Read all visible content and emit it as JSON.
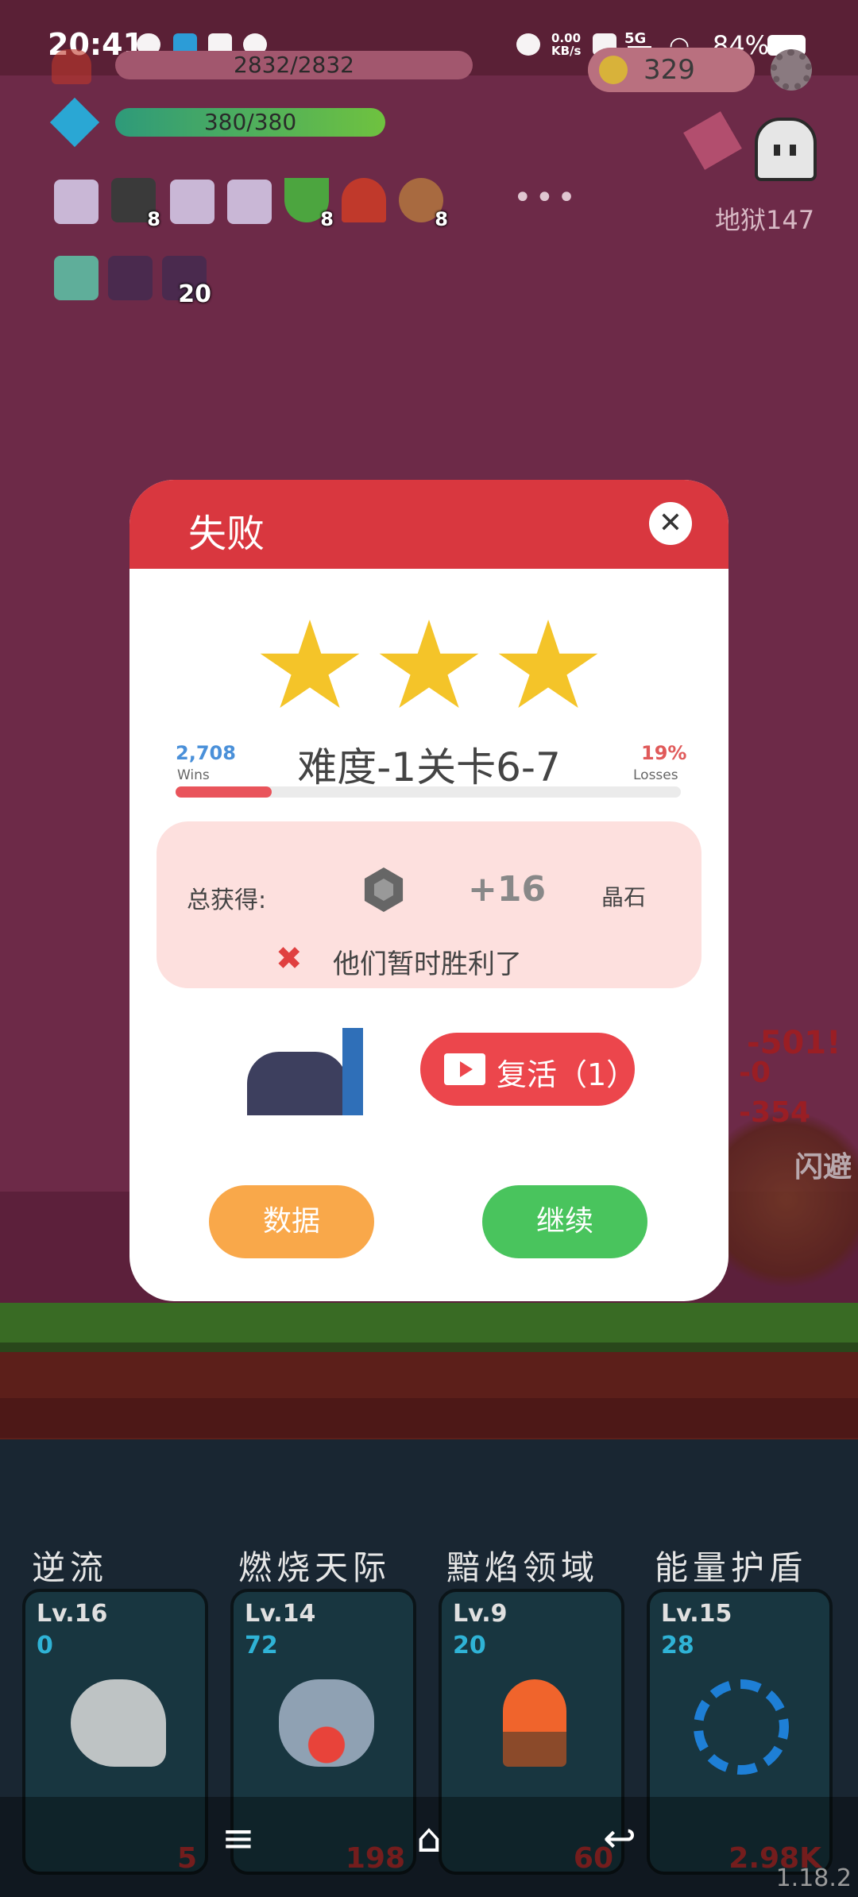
{
  "status_bar": {
    "time": "20:41",
    "network_speed": "0.00\nKB/s",
    "network_type": "5G",
    "battery_percent": "84%"
  },
  "hud": {
    "hp_text": "2832/2832",
    "mana_text": "380/380",
    "gold_amount": "329",
    "hell_level": "地狱147",
    "overflow_dots": "•••",
    "items": [
      {
        "icon": "scroll-icon",
        "count": ""
      },
      {
        "icon": "skull-book-icon",
        "count": "8"
      },
      {
        "icon": "scroll-icon",
        "count": ""
      },
      {
        "icon": "scroll-icon",
        "count": ""
      },
      {
        "icon": "watermelon-icon",
        "count": "8"
      },
      {
        "icon": "magnet-icon",
        "count": ""
      },
      {
        "icon": "target-icon",
        "count": "8"
      }
    ],
    "buffs": [
      {
        "icon": "lightbulb-icon",
        "count": ""
      },
      {
        "icon": "demon-face-icon",
        "count": ""
      },
      {
        "icon": "demon-face-icon",
        "count": "20"
      }
    ]
  },
  "dialog": {
    "title": "失败",
    "close_label": "✕",
    "stars": 3,
    "wins_count": "2,708",
    "wins_label": "Wins",
    "level_title": "难度-1关卡6-7",
    "loss_percent": "19%",
    "loss_label": "Losses",
    "loss_fraction": 0.19,
    "reward_label": "总获得:",
    "reward_amount": "+16",
    "reward_unit": "晶石",
    "fail_icon": "✖",
    "fail_text": "他们暂时胜利了",
    "revive_label": "复活（1）",
    "data_button": "数据",
    "continue_button": "继续"
  },
  "battle_fx": {
    "damage_1": "-501!",
    "damage_2": "-0",
    "damage_3": "-354",
    "dodge_text": "闪避"
  },
  "skills": [
    {
      "name": "逆流",
      "level": "Lv.16",
      "cooldown": "0",
      "cost": "5",
      "icon": "wind-cloud-icon"
    },
    {
      "name": "燃烧天际",
      "level": "Lv.14",
      "cooldown": "72",
      "cost": "198",
      "icon": "fire-cloud-icon"
    },
    {
      "name": "黯焰领域",
      "level": "Lv.9",
      "cooldown": "20",
      "cost": "60",
      "icon": "campfire-icon"
    },
    {
      "name": "能量护盾",
      "level": "Lv.15",
      "cooldown": "28",
      "cost": "2.98K",
      "icon": "refresh-shield-icon"
    }
  ],
  "version": "1.18.2",
  "colors": {
    "dialog_header": "#d9373f",
    "revive_button": "#ec464c",
    "data_button": "#f9a84a",
    "continue_button": "#49c45d",
    "star": "#f4c429"
  }
}
